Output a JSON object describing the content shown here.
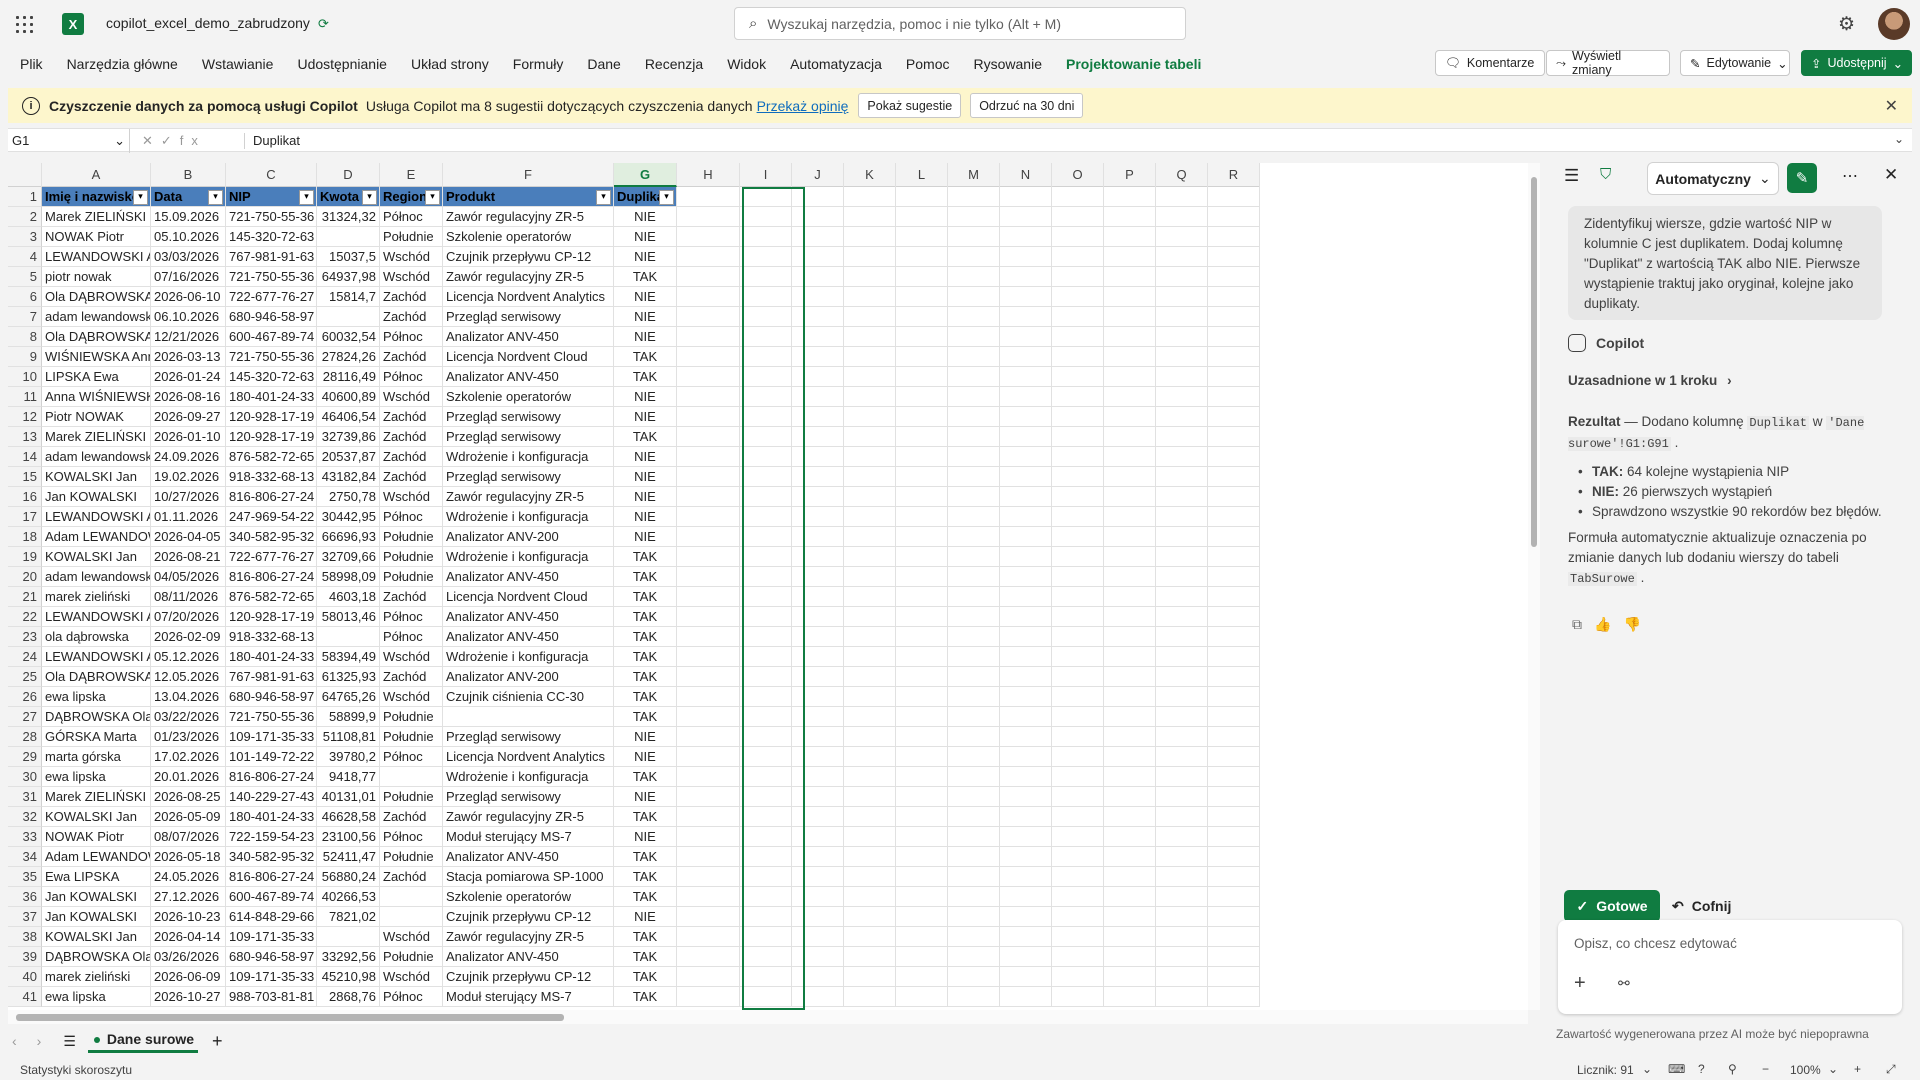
{
  "app": {
    "doc_title": "copilot_excel_demo_zabrudzony",
    "search_placeholder": "Wyszukaj narzędzia, pomoc i nie tylko (Alt + M)",
    "logo": "X"
  },
  "ribbon": {
    "tabs": [
      "Plik",
      "Narzędzia główne",
      "Wstawianie",
      "Udostępnianie",
      "Układ strony",
      "Formuły",
      "Dane",
      "Recenzja",
      "Widok",
      "Automatyzacja",
      "Pomoc",
      "Rysowanie",
      "Projektowanie tabeli"
    ],
    "active_tab": "Projektowanie tabeli",
    "comments": "Komentarze",
    "show_changes": "Wyświetl zmiany",
    "editing": "Edytowanie",
    "share": "Udostępnij"
  },
  "banner": {
    "title": "Czyszczenie danych za pomocą usługi Copilot",
    "text": "Usługa Copilot ma 8 sugestii dotyczących czyszczenia danych",
    "link": "Przekaż opinię",
    "show_btn": "Pokaż sugestie",
    "dismiss_btn": "Odrzuć na 30 dni"
  },
  "formula_bar": {
    "cell": "G1",
    "content": "Duplikat"
  },
  "columns": [
    "A",
    "B",
    "C",
    "D",
    "E",
    "F",
    "G",
    "H",
    "I",
    "J",
    "K",
    "L",
    "M",
    "N",
    "O",
    "P",
    "Q",
    "R"
  ],
  "selected_column": "G",
  "table": {
    "headers": [
      "Imię i nazwisko",
      "Data",
      "NIP",
      "Kwota",
      "Region",
      "Produkt",
      "Duplikat"
    ],
    "rows": [
      [
        "Marek ZIELIŃSKI",
        "15.09.2026",
        "721-750-55-36",
        "31324,32",
        "Północ",
        "Zawór regulacyjny ZR-5",
        "NIE"
      ],
      [
        "NOWAK Piotr",
        "05.10.2026",
        "145-320-72-63",
        "",
        "Południe",
        "Szkolenie operatorów",
        "NIE"
      ],
      [
        "LEWANDOWSKI Adam",
        "03/03/2026",
        "767-981-91-63",
        "15037,5",
        "Wschód",
        "Czujnik przepływu CP-12",
        "NIE"
      ],
      [
        "piotr nowak",
        "07/16/2026",
        "721-750-55-36",
        "64937,98",
        "Wschód",
        "Zawór regulacyjny ZR-5",
        "TAK"
      ],
      [
        "Ola DĄBROWSKA",
        "2026-06-10",
        "722-677-76-27",
        "15814,7",
        "Zachód",
        "Licencja Nordvent Analytics",
        "NIE"
      ],
      [
        "adam lewandowski",
        "06.10.2026",
        "680-946-58-97",
        "",
        "Zachód",
        "Przegląd serwisowy",
        "NIE"
      ],
      [
        "Ola DĄBROWSKA",
        "12/21/2026",
        "600-467-89-74",
        "60032,54",
        "Północ",
        "Analizator ANV-450",
        "NIE"
      ],
      [
        "WIŚNIEWSKA Anna",
        "2026-03-13",
        "721-750-55-36",
        "27824,26",
        "Zachód",
        "Licencja Nordvent Cloud",
        "TAK"
      ],
      [
        "LIPSKA Ewa",
        "2026-01-24",
        "145-320-72-63",
        "28116,49",
        "Północ",
        "Analizator ANV-450",
        "TAK"
      ],
      [
        "Anna WIŚNIEWSKA",
        "2026-08-16",
        "180-401-24-33",
        "40600,89",
        "Wschód",
        "Szkolenie operatorów",
        "NIE"
      ],
      [
        "Piotr NOWAK",
        "2026-09-27",
        "120-928-17-19",
        "46406,54",
        "Zachód",
        "Przegląd serwisowy",
        "NIE"
      ],
      [
        "Marek ZIELIŃSKI",
        "2026-01-10",
        "120-928-17-19",
        "32739,86",
        "Zachód",
        "Przegląd serwisowy",
        "TAK"
      ],
      [
        "adam lewandowski",
        "24.09.2026",
        "876-582-72-65",
        "20537,87",
        "Zachód",
        "Wdrożenie i konfiguracja",
        "NIE"
      ],
      [
        "KOWALSKI Jan",
        "19.02.2026",
        "918-332-68-13",
        "43182,84",
        "Zachód",
        "Przegląd serwisowy",
        "NIE"
      ],
      [
        "Jan KOWALSKI",
        "10/27/2026",
        "816-806-27-24",
        "2750,78",
        "Wschód",
        "Zawór regulacyjny ZR-5",
        "NIE"
      ],
      [
        "LEWANDOWSKI Adam",
        "01.11.2026",
        "247-969-54-22",
        "30442,95",
        "Północ",
        "Wdrożenie i konfiguracja",
        "NIE"
      ],
      [
        "Adam LEWANDOWSKI",
        "2026-04-05",
        "340-582-95-32",
        "66696,93",
        "Południe",
        "Analizator ANV-200",
        "NIE"
      ],
      [
        "KOWALSKI Jan",
        "2026-08-21",
        "722-677-76-27",
        "32709,66",
        "Południe",
        "Wdrożenie i konfiguracja",
        "TAK"
      ],
      [
        "adam lewandowski",
        "04/05/2026",
        "816-806-27-24",
        "58998,09",
        "Południe",
        "Analizator ANV-450",
        "TAK"
      ],
      [
        "marek zieliński",
        "08/11/2026",
        "876-582-72-65",
        "4603,18",
        "Zachód",
        "Licencja Nordvent Cloud",
        "TAK"
      ],
      [
        "LEWANDOWSKI Adam",
        "07/20/2026",
        "120-928-17-19",
        "58013,46",
        "Północ",
        "Analizator ANV-450",
        "TAK"
      ],
      [
        "ola dąbrowska",
        "2026-02-09",
        "918-332-68-13",
        "",
        "Północ",
        "Analizator ANV-450",
        "TAK"
      ],
      [
        "LEWANDOWSKI Adam",
        "05.12.2026",
        "180-401-24-33",
        "58394,49",
        "Wschód",
        "Wdrożenie i konfiguracja",
        "TAK"
      ],
      [
        "Ola DĄBROWSKA",
        "12.05.2026",
        "767-981-91-63",
        "61325,93",
        "Zachód",
        "Analizator ANV-200",
        "TAK"
      ],
      [
        "ewa lipska",
        "13.04.2026",
        "680-946-58-97",
        "64765,26",
        "Wschód",
        "Czujnik ciśnienia CC-30",
        "TAK"
      ],
      [
        "DĄBROWSKA Ola",
        "03/22/2026",
        "721-750-55-36",
        "58899,9",
        "Południe",
        "",
        "TAK"
      ],
      [
        "GÓRSKA Marta",
        "01/23/2026",
        "109-171-35-33",
        "51108,81",
        "Południe",
        "Przegląd serwisowy",
        "NIE"
      ],
      [
        "marta górska",
        "17.02.2026",
        "101-149-72-22",
        "39780,2",
        "Północ",
        "Licencja Nordvent Analytics",
        "NIE"
      ],
      [
        "ewa lipska",
        "20.01.2026",
        "816-806-27-24",
        "9418,77",
        "",
        "Wdrożenie i konfiguracja",
        "TAK"
      ],
      [
        "Marek ZIELIŃSKI",
        "2026-08-25",
        "140-229-27-43",
        "40131,01",
        "Południe",
        "Przegląd serwisowy",
        "NIE"
      ],
      [
        "KOWALSKI Jan",
        "2026-05-09",
        "180-401-24-33",
        "46628,58",
        "Zachód",
        "Zawór regulacyjny ZR-5",
        "TAK"
      ],
      [
        "NOWAK Piotr",
        "08/07/2026",
        "722-159-54-23",
        "23100,56",
        "Północ",
        "Moduł sterujący MS-7",
        "NIE"
      ],
      [
        "Adam LEWANDOWSKI",
        "2026-05-18",
        "340-582-95-32",
        "52411,47",
        "Południe",
        "Analizator ANV-450",
        "TAK"
      ],
      [
        "Ewa LIPSKA",
        "24.05.2026",
        "816-806-27-24",
        "56880,24",
        "Zachód",
        "Stacja pomiarowa SP-1000",
        "TAK"
      ],
      [
        "Jan KOWALSKI",
        "27.12.2026",
        "600-467-89-74",
        "40266,53",
        "",
        "Szkolenie operatorów",
        "TAK"
      ],
      [
        "Jan KOWALSKI",
        "2026-10-23",
        "614-848-29-66",
        "7821,02",
        "",
        "Czujnik przepływu CP-12",
        "NIE"
      ],
      [
        "KOWALSKI Jan",
        "2026-04-14",
        "109-171-35-33",
        "",
        "Wschód",
        "Zawór regulacyjny ZR-5",
        "TAK"
      ],
      [
        "DĄBROWSKA Ola",
        "03/26/2026",
        "680-946-58-97",
        "33292,56",
        "Południe",
        "Analizator ANV-450",
        "TAK"
      ],
      [
        "marek zieliński",
        "2026-06-09",
        "109-171-35-33",
        "45210,98",
        "Wschód",
        "Czujnik przepływu CP-12",
        "TAK"
      ],
      [
        "ewa lipska",
        "2026-10-27",
        "988-703-81-81",
        "2868,76",
        "Północ",
        "Moduł sterujący MS-7",
        "TAK"
      ]
    ]
  },
  "sheet": {
    "tab": "Dane surowe",
    "status_left": "Statystyki skoroszytu",
    "count": "Licznik: 91",
    "zoom": "100%"
  },
  "copilot": {
    "mode": "Automatyczny",
    "prompt": "Zidentyfikuj wiersze, gdzie wartość NIP w kolumnie C jest duplikatem. Dodaj kolumnę \"Duplikat\" z wartością TAK albo NIE. Pierwsze wystąpienie traktuj jako oryginał, kolejne jako duplikaty.",
    "source": "Copilot",
    "based_on": "Uzasadnione w 1 kroku",
    "result_label": "Rezultat",
    "result_pre": "— Dodano kolumnę",
    "result_code": "Duplikat",
    "result_mid": "w",
    "result_range": "'Dane surowe'!G1:G91",
    "bullets": [
      {
        "bold": "TAK:",
        "text": "64 kolejne wystąpienia NIP"
      },
      {
        "bold": "NIE:",
        "text": "26 pierwszych wystąpień"
      },
      {
        "bold": "",
        "text": "Sprawdzono wszystkie 90 rekordów bez błędów."
      }
    ],
    "note_pre": "Formuła automatycznie aktualizuje oznaczenia po zmianie danych lub dodaniu wierszy do tabeli",
    "note_code": "TabSurowe",
    "done": "Gotowe",
    "undo": "Cofnij",
    "input_placeholder": "Opisz, co chcesz edytować",
    "disclaimer": "Zawartość wygenerowana przez AI może być niepoprawna"
  }
}
